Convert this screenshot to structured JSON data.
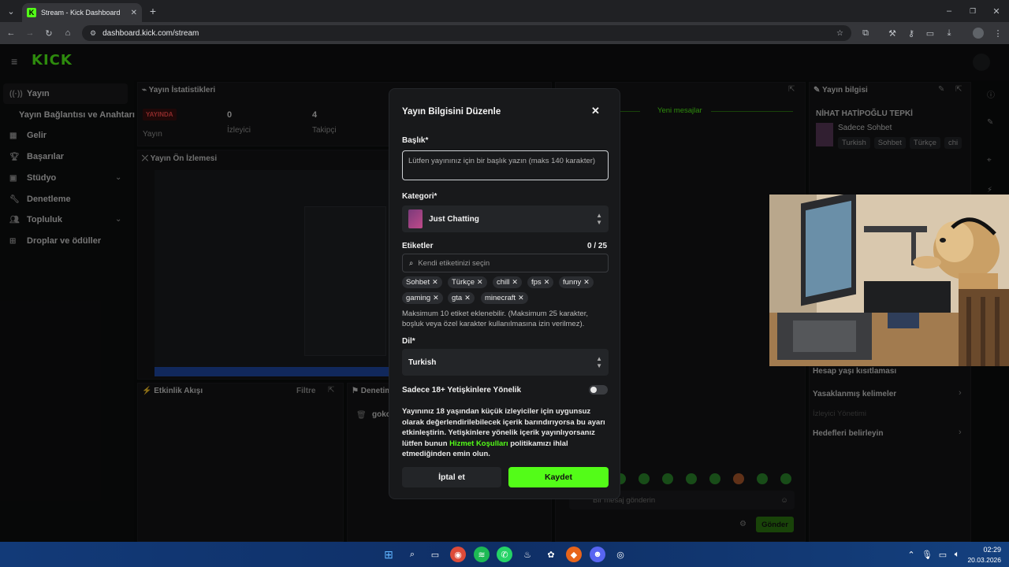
{
  "browser": {
    "tab_title": "Stream - Kick Dashboard",
    "tab_favicon": "K",
    "url": "dashboard.kick.com/stream"
  },
  "app": {
    "logo": "KICK",
    "sidebar": [
      {
        "label": "Yayın",
        "icon": "stream-icon"
      },
      {
        "label": "Yayın Bağlantısı ve Anahtarı",
        "icon": ""
      },
      {
        "label": "Gelir",
        "icon": "revenue-icon"
      },
      {
        "label": "Başarılar",
        "icon": "trophy-icon"
      },
      {
        "label": "Stüdyo",
        "icon": "studio-icon"
      },
      {
        "label": "Denetleme",
        "icon": "wrench-icon"
      },
      {
        "label": "Topluluk",
        "icon": "community-icon"
      },
      {
        "label": "Droplar ve ödüller",
        "icon": "gift-icon"
      }
    ],
    "stats": {
      "title": "Yayın İstatistikleri",
      "live_badge": "YAYINDA",
      "live_label": "Yayın",
      "viewers_value": "0",
      "viewers_label": "İzleyici",
      "followers_value": "4",
      "followers_label": "Takipçi"
    },
    "preview_title": "Yayın Ön İzlemesi",
    "activity": {
      "title": "Etkinlik Akışı",
      "filter": "Filtre"
    },
    "moderation": {
      "title": "Denetim",
      "user": "goko"
    },
    "chat": {
      "new_messages": "Yeni mesajlar",
      "input_placeholder": "Bir mesaj gönderin",
      "send": "Gönder"
    },
    "stream_info": {
      "title": "Yayın bilgisi",
      "stream_title": "NİHAT HATİPOĞLU TEPKİ",
      "category": "Sadece Sohbet",
      "tags": [
        "Turkish",
        "Sohbet",
        "Türkçe",
        "chi"
      ],
      "links": [
        "Hesap yaşı kısıtlaması",
        "Yasaklanmış kelimeler",
        "İzleyici Yönetimi",
        "Hedefleri belirleyin"
      ]
    }
  },
  "modal": {
    "title": "Yayın Bilgisini Düzenle",
    "title_label": "Başlık*",
    "title_placeholder": "Lütfen yayınınız için bir başlık yazın (maks 140 karakter)",
    "category_label": "Kategori*",
    "category_value": "Just Chatting",
    "tags_label": "Etiketler",
    "tags_count": "0 / 25",
    "tags_search_placeholder": "Kendi etiketinizi seçin",
    "tags": [
      "Sohbet",
      "Türkçe",
      "chill",
      "fps",
      "funny",
      "gaming",
      "gta",
      "minecraft"
    ],
    "tags_help": "Maksimum 10 etiket eklenebilir. (Maksimum 25 karakter, boşluk veya özel karakter kullanılmasına izin verilmez).",
    "language_label": "Dil*",
    "language_value": "Turkish",
    "adult_label": "Sadece 18+ Yetişkinlere Yönelik",
    "adult_enabled": false,
    "adult_help_1": "Yayınınız 18 yaşından küçük izleyiciler için uygunsuz olarak değerlendirilebilecek içerik barındırıyorsa bu ayarı etkinleştirin. Yetişkinlere yönelik içerik yayınlıyorsanız lütfen bunun ",
    "adult_help_link": "Hizmet Koşulları",
    "adult_help_2": " politikamızı ihlal etmediğinden emin olun.",
    "cancel": "İptal et",
    "save": "Kaydet"
  },
  "taskbar": {
    "time": "02:29",
    "date": "20.03.2026"
  },
  "colors": {
    "accent": "#53fc18",
    "modal_bg": "#18191b",
    "page_bg": "#0c0d0e"
  }
}
